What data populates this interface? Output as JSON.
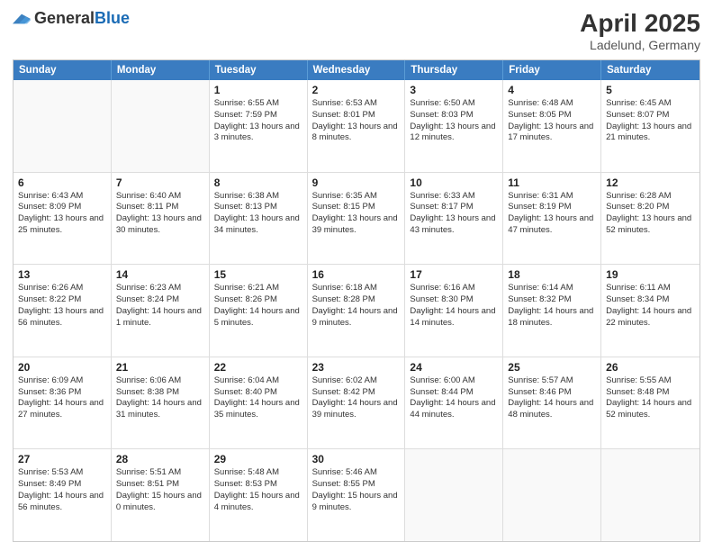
{
  "header": {
    "logo_general": "General",
    "logo_blue": "Blue",
    "month": "April 2025",
    "location": "Ladelund, Germany"
  },
  "days_of_week": [
    "Sunday",
    "Monday",
    "Tuesday",
    "Wednesday",
    "Thursday",
    "Friday",
    "Saturday"
  ],
  "weeks": [
    [
      {
        "day": "",
        "info": ""
      },
      {
        "day": "",
        "info": ""
      },
      {
        "day": "1",
        "info": "Sunrise: 6:55 AM\nSunset: 7:59 PM\nDaylight: 13 hours and 3 minutes."
      },
      {
        "day": "2",
        "info": "Sunrise: 6:53 AM\nSunset: 8:01 PM\nDaylight: 13 hours and 8 minutes."
      },
      {
        "day": "3",
        "info": "Sunrise: 6:50 AM\nSunset: 8:03 PM\nDaylight: 13 hours and 12 minutes."
      },
      {
        "day": "4",
        "info": "Sunrise: 6:48 AM\nSunset: 8:05 PM\nDaylight: 13 hours and 17 minutes."
      },
      {
        "day": "5",
        "info": "Sunrise: 6:45 AM\nSunset: 8:07 PM\nDaylight: 13 hours and 21 minutes."
      }
    ],
    [
      {
        "day": "6",
        "info": "Sunrise: 6:43 AM\nSunset: 8:09 PM\nDaylight: 13 hours and 25 minutes."
      },
      {
        "day": "7",
        "info": "Sunrise: 6:40 AM\nSunset: 8:11 PM\nDaylight: 13 hours and 30 minutes."
      },
      {
        "day": "8",
        "info": "Sunrise: 6:38 AM\nSunset: 8:13 PM\nDaylight: 13 hours and 34 minutes."
      },
      {
        "day": "9",
        "info": "Sunrise: 6:35 AM\nSunset: 8:15 PM\nDaylight: 13 hours and 39 minutes."
      },
      {
        "day": "10",
        "info": "Sunrise: 6:33 AM\nSunset: 8:17 PM\nDaylight: 13 hours and 43 minutes."
      },
      {
        "day": "11",
        "info": "Sunrise: 6:31 AM\nSunset: 8:19 PM\nDaylight: 13 hours and 47 minutes."
      },
      {
        "day": "12",
        "info": "Sunrise: 6:28 AM\nSunset: 8:20 PM\nDaylight: 13 hours and 52 minutes."
      }
    ],
    [
      {
        "day": "13",
        "info": "Sunrise: 6:26 AM\nSunset: 8:22 PM\nDaylight: 13 hours and 56 minutes."
      },
      {
        "day": "14",
        "info": "Sunrise: 6:23 AM\nSunset: 8:24 PM\nDaylight: 14 hours and 1 minute."
      },
      {
        "day": "15",
        "info": "Sunrise: 6:21 AM\nSunset: 8:26 PM\nDaylight: 14 hours and 5 minutes."
      },
      {
        "day": "16",
        "info": "Sunrise: 6:18 AM\nSunset: 8:28 PM\nDaylight: 14 hours and 9 minutes."
      },
      {
        "day": "17",
        "info": "Sunrise: 6:16 AM\nSunset: 8:30 PM\nDaylight: 14 hours and 14 minutes."
      },
      {
        "day": "18",
        "info": "Sunrise: 6:14 AM\nSunset: 8:32 PM\nDaylight: 14 hours and 18 minutes."
      },
      {
        "day": "19",
        "info": "Sunrise: 6:11 AM\nSunset: 8:34 PM\nDaylight: 14 hours and 22 minutes."
      }
    ],
    [
      {
        "day": "20",
        "info": "Sunrise: 6:09 AM\nSunset: 8:36 PM\nDaylight: 14 hours and 27 minutes."
      },
      {
        "day": "21",
        "info": "Sunrise: 6:06 AM\nSunset: 8:38 PM\nDaylight: 14 hours and 31 minutes."
      },
      {
        "day": "22",
        "info": "Sunrise: 6:04 AM\nSunset: 8:40 PM\nDaylight: 14 hours and 35 minutes."
      },
      {
        "day": "23",
        "info": "Sunrise: 6:02 AM\nSunset: 8:42 PM\nDaylight: 14 hours and 39 minutes."
      },
      {
        "day": "24",
        "info": "Sunrise: 6:00 AM\nSunset: 8:44 PM\nDaylight: 14 hours and 44 minutes."
      },
      {
        "day": "25",
        "info": "Sunrise: 5:57 AM\nSunset: 8:46 PM\nDaylight: 14 hours and 48 minutes."
      },
      {
        "day": "26",
        "info": "Sunrise: 5:55 AM\nSunset: 8:48 PM\nDaylight: 14 hours and 52 minutes."
      }
    ],
    [
      {
        "day": "27",
        "info": "Sunrise: 5:53 AM\nSunset: 8:49 PM\nDaylight: 14 hours and 56 minutes."
      },
      {
        "day": "28",
        "info": "Sunrise: 5:51 AM\nSunset: 8:51 PM\nDaylight: 15 hours and 0 minutes."
      },
      {
        "day": "29",
        "info": "Sunrise: 5:48 AM\nSunset: 8:53 PM\nDaylight: 15 hours and 4 minutes."
      },
      {
        "day": "30",
        "info": "Sunrise: 5:46 AM\nSunset: 8:55 PM\nDaylight: 15 hours and 9 minutes."
      },
      {
        "day": "",
        "info": ""
      },
      {
        "day": "",
        "info": ""
      },
      {
        "day": "",
        "info": ""
      }
    ]
  ]
}
